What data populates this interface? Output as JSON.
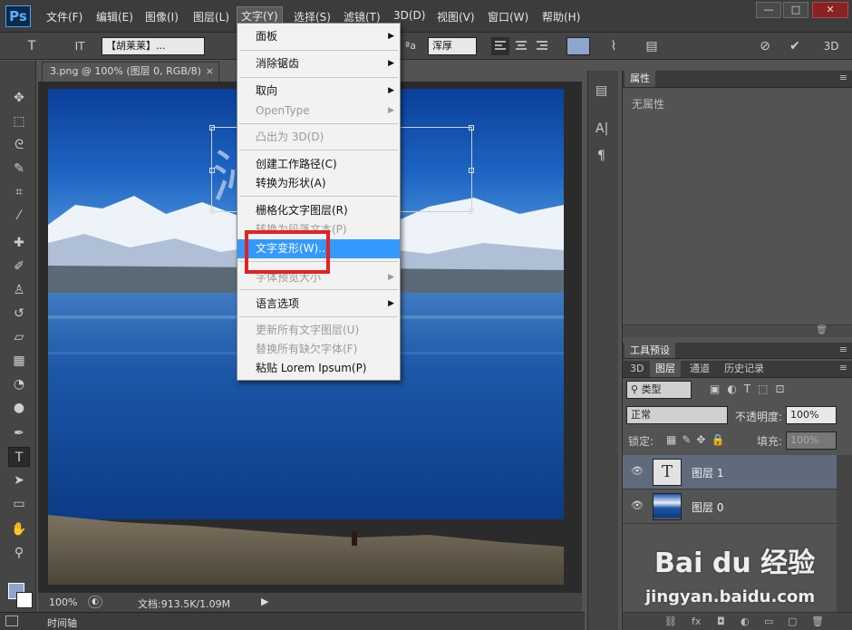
{
  "app": {
    "logo": "Ps"
  },
  "menubar": {
    "items": [
      "文件(F)",
      "编辑(E)",
      "图像(I)",
      "图层(L)",
      "文字(Y)",
      "选择(S)",
      "滤镜(T)",
      "3D(D)",
      "视图(V)",
      "窗口(W)",
      "帮助(H)"
    ],
    "active_index": 4,
    "window_buttons": [
      "—",
      "□",
      "✕"
    ]
  },
  "options_bar": {
    "tool_icon": "T",
    "orient_icon": "IT",
    "font_family": "【胡莱莱】...",
    "aa_label": "ªa",
    "aa_mode": "浑厚",
    "color_swatch": "#8fa6cc"
  },
  "document": {
    "tab_title": "3.png @ 100% (图层 0, RGB/8)",
    "tab_close": "×",
    "overlay_text": "沁  色"
  },
  "text_menu": {
    "items": [
      {
        "label": "面板",
        "submenu": true,
        "disabled": false
      },
      {
        "label": "消除锯齿",
        "submenu": true,
        "disabled": false
      },
      {
        "label": "取向",
        "submenu": true,
        "disabled": false
      },
      {
        "label": "OpenType",
        "submenu": true,
        "disabled": true
      },
      {
        "label": "凸出为 3D(D)",
        "submenu": false,
        "disabled": true
      },
      {
        "label": "创建工作路径(C)",
        "submenu": false,
        "disabled": false
      },
      {
        "label": "转换为形状(A)",
        "submenu": false,
        "disabled": false
      },
      {
        "label": "栅格化文字图层(R)",
        "submenu": false,
        "disabled": false
      },
      {
        "label": "转换为段落文本(P)",
        "submenu": false,
        "disabled": true
      },
      {
        "label": "文字变形(W)...",
        "submenu": false,
        "disabled": false,
        "highlighted": true
      },
      {
        "label": "字体预览大小",
        "submenu": true,
        "disabled": true
      },
      {
        "label": "语言选项",
        "submenu": true,
        "disabled": false
      },
      {
        "label": "更新所有文字图层(U)",
        "submenu": false,
        "disabled": true
      },
      {
        "label": "替换所有缺欠字体(F)",
        "submenu": false,
        "disabled": true
      },
      {
        "label": "粘贴 Lorem Ipsum(P)",
        "submenu": false,
        "disabled": false
      }
    ],
    "arrow": "▶"
  },
  "status": {
    "zoom": "100%",
    "doc_info": "文档:913.5K/1.09M",
    "timeline_label": "时间轴"
  },
  "properties_panel": {
    "tab": "属性",
    "empty_text": "无属性"
  },
  "tool_presets": {
    "tab": "工具预设"
  },
  "layers_panel": {
    "tabs": [
      "3D",
      "图层",
      "通道",
      "历史记录"
    ],
    "active_tab_index": 1,
    "filter_label": "类型",
    "blend_mode": "正常",
    "opacity_label": "不透明度:",
    "opacity_value": "100%",
    "lock_label": "锁定:",
    "fill_label": "填充:",
    "fill_value": "100%",
    "layers": [
      {
        "name": "图层 1",
        "type": "text",
        "selected": true
      },
      {
        "name": "图层 0",
        "type": "image",
        "selected": false
      }
    ]
  },
  "watermark": {
    "brand": "Bai du 经验",
    "url": "jingyan.baidu.com"
  }
}
